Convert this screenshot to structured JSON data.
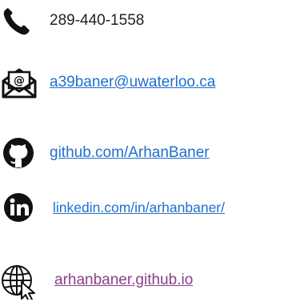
{
  "contacts": {
    "phone": {
      "text": "289-440-1558",
      "icon": "phone-icon"
    },
    "email": {
      "text": "a39baner@uwaterloo.ca",
      "icon": "email-icon"
    },
    "github": {
      "text": "github.com/ArhanBaner",
      "icon": "github-icon"
    },
    "linkedin": {
      "text": "linkedin.com/in/arhanbaner/",
      "icon": "linkedin-icon"
    },
    "website": {
      "text": "arhanbaner.github.io",
      "icon": "globe-cursor-icon"
    }
  },
  "colors": {
    "link": "#1f6fce",
    "visited_link": "#8a3f8a",
    "text": "#222222",
    "icon": "#111111"
  }
}
